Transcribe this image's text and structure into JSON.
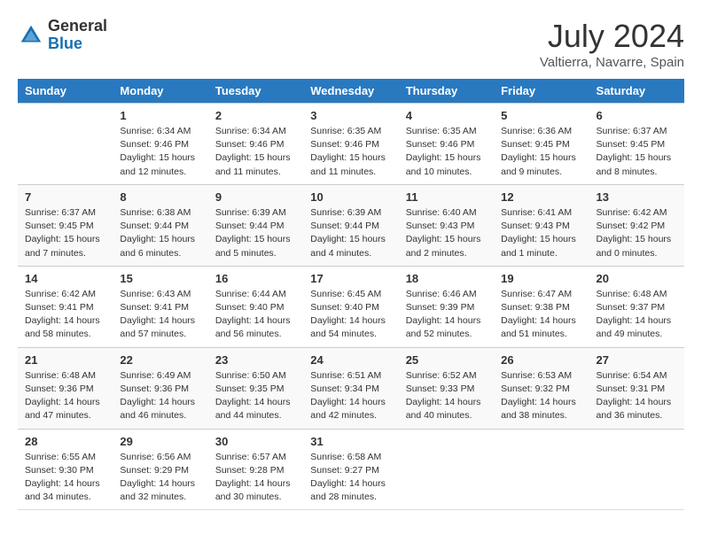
{
  "header": {
    "logo_general": "General",
    "logo_blue": "Blue",
    "month_year": "July 2024",
    "location": "Valtierra, Navarre, Spain"
  },
  "days_of_week": [
    "Sunday",
    "Monday",
    "Tuesday",
    "Wednesday",
    "Thursday",
    "Friday",
    "Saturday"
  ],
  "weeks": [
    [
      {
        "day": "",
        "info": ""
      },
      {
        "day": "1",
        "info": "Sunrise: 6:34 AM\nSunset: 9:46 PM\nDaylight: 15 hours\nand 12 minutes."
      },
      {
        "day": "2",
        "info": "Sunrise: 6:34 AM\nSunset: 9:46 PM\nDaylight: 15 hours\nand 11 minutes."
      },
      {
        "day": "3",
        "info": "Sunrise: 6:35 AM\nSunset: 9:46 PM\nDaylight: 15 hours\nand 11 minutes."
      },
      {
        "day": "4",
        "info": "Sunrise: 6:35 AM\nSunset: 9:46 PM\nDaylight: 15 hours\nand 10 minutes."
      },
      {
        "day": "5",
        "info": "Sunrise: 6:36 AM\nSunset: 9:45 PM\nDaylight: 15 hours\nand 9 minutes."
      },
      {
        "day": "6",
        "info": "Sunrise: 6:37 AM\nSunset: 9:45 PM\nDaylight: 15 hours\nand 8 minutes."
      }
    ],
    [
      {
        "day": "7",
        "info": "Sunrise: 6:37 AM\nSunset: 9:45 PM\nDaylight: 15 hours\nand 7 minutes."
      },
      {
        "day": "8",
        "info": "Sunrise: 6:38 AM\nSunset: 9:44 PM\nDaylight: 15 hours\nand 6 minutes."
      },
      {
        "day": "9",
        "info": "Sunrise: 6:39 AM\nSunset: 9:44 PM\nDaylight: 15 hours\nand 5 minutes."
      },
      {
        "day": "10",
        "info": "Sunrise: 6:39 AM\nSunset: 9:44 PM\nDaylight: 15 hours\nand 4 minutes."
      },
      {
        "day": "11",
        "info": "Sunrise: 6:40 AM\nSunset: 9:43 PM\nDaylight: 15 hours\nand 2 minutes."
      },
      {
        "day": "12",
        "info": "Sunrise: 6:41 AM\nSunset: 9:43 PM\nDaylight: 15 hours\nand 1 minute."
      },
      {
        "day": "13",
        "info": "Sunrise: 6:42 AM\nSunset: 9:42 PM\nDaylight: 15 hours\nand 0 minutes."
      }
    ],
    [
      {
        "day": "14",
        "info": "Sunrise: 6:42 AM\nSunset: 9:41 PM\nDaylight: 14 hours\nand 58 minutes."
      },
      {
        "day": "15",
        "info": "Sunrise: 6:43 AM\nSunset: 9:41 PM\nDaylight: 14 hours\nand 57 minutes."
      },
      {
        "day": "16",
        "info": "Sunrise: 6:44 AM\nSunset: 9:40 PM\nDaylight: 14 hours\nand 56 minutes."
      },
      {
        "day": "17",
        "info": "Sunrise: 6:45 AM\nSunset: 9:40 PM\nDaylight: 14 hours\nand 54 minutes."
      },
      {
        "day": "18",
        "info": "Sunrise: 6:46 AM\nSunset: 9:39 PM\nDaylight: 14 hours\nand 52 minutes."
      },
      {
        "day": "19",
        "info": "Sunrise: 6:47 AM\nSunset: 9:38 PM\nDaylight: 14 hours\nand 51 minutes."
      },
      {
        "day": "20",
        "info": "Sunrise: 6:48 AM\nSunset: 9:37 PM\nDaylight: 14 hours\nand 49 minutes."
      }
    ],
    [
      {
        "day": "21",
        "info": "Sunrise: 6:48 AM\nSunset: 9:36 PM\nDaylight: 14 hours\nand 47 minutes."
      },
      {
        "day": "22",
        "info": "Sunrise: 6:49 AM\nSunset: 9:36 PM\nDaylight: 14 hours\nand 46 minutes."
      },
      {
        "day": "23",
        "info": "Sunrise: 6:50 AM\nSunset: 9:35 PM\nDaylight: 14 hours\nand 44 minutes."
      },
      {
        "day": "24",
        "info": "Sunrise: 6:51 AM\nSunset: 9:34 PM\nDaylight: 14 hours\nand 42 minutes."
      },
      {
        "day": "25",
        "info": "Sunrise: 6:52 AM\nSunset: 9:33 PM\nDaylight: 14 hours\nand 40 minutes."
      },
      {
        "day": "26",
        "info": "Sunrise: 6:53 AM\nSunset: 9:32 PM\nDaylight: 14 hours\nand 38 minutes."
      },
      {
        "day": "27",
        "info": "Sunrise: 6:54 AM\nSunset: 9:31 PM\nDaylight: 14 hours\nand 36 minutes."
      }
    ],
    [
      {
        "day": "28",
        "info": "Sunrise: 6:55 AM\nSunset: 9:30 PM\nDaylight: 14 hours\nand 34 minutes."
      },
      {
        "day": "29",
        "info": "Sunrise: 6:56 AM\nSunset: 9:29 PM\nDaylight: 14 hours\nand 32 minutes."
      },
      {
        "day": "30",
        "info": "Sunrise: 6:57 AM\nSunset: 9:28 PM\nDaylight: 14 hours\nand 30 minutes."
      },
      {
        "day": "31",
        "info": "Sunrise: 6:58 AM\nSunset: 9:27 PM\nDaylight: 14 hours\nand 28 minutes."
      },
      {
        "day": "",
        "info": ""
      },
      {
        "day": "",
        "info": ""
      },
      {
        "day": "",
        "info": ""
      }
    ]
  ]
}
